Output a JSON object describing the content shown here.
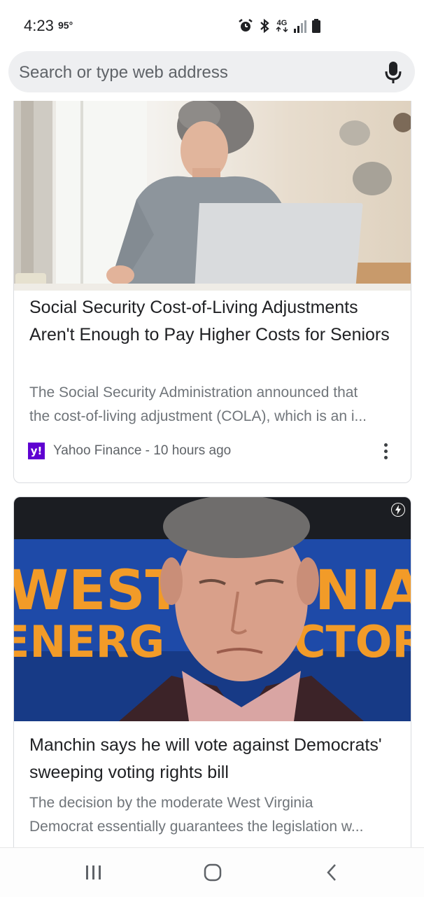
{
  "status_bar": {
    "time": "4:23",
    "temperature": "95°",
    "network": "4G",
    "icons": [
      "alarm-icon",
      "bluetooth-icon",
      "lte-icon",
      "signal-icon",
      "battery-icon"
    ]
  },
  "search": {
    "placeholder": "Search or type web address",
    "mic_icon": "mic-icon"
  },
  "feed": {
    "cards": [
      {
        "title": "Social Security Cost-of-Living Adjustments Aren't Enough to Pay Higher Costs for Seniors",
        "snippet_line1": "The Social Security Administration announced that",
        "snippet_line2": "the cost-of-living adjustment (COLA), which is an i...",
        "source": "Yahoo Finance - 10 hours ago",
        "source_logo": "y!",
        "image_alt": "woman-at-laptop-photo"
      },
      {
        "title": "Manchin says he will vote against Democrats' sweeping voting rights bill",
        "snippet_line1": "The decision by the moderate West Virginia",
        "snippet_line2": "Democrat essentially guarantees the legislation w...",
        "banner_text_1": "WEST VIRGINIA",
        "banner_text_2": "ENERGY VICTOR",
        "image_alt": "manchin-photo",
        "badge_icon": "amp-bolt-icon"
      }
    ]
  },
  "colors": {
    "search_bg": "#eeeff1",
    "yahoo_purple": "#5f01d1",
    "banner_blue": "#1e4aa8",
    "banner_orange": "#f29b28"
  }
}
